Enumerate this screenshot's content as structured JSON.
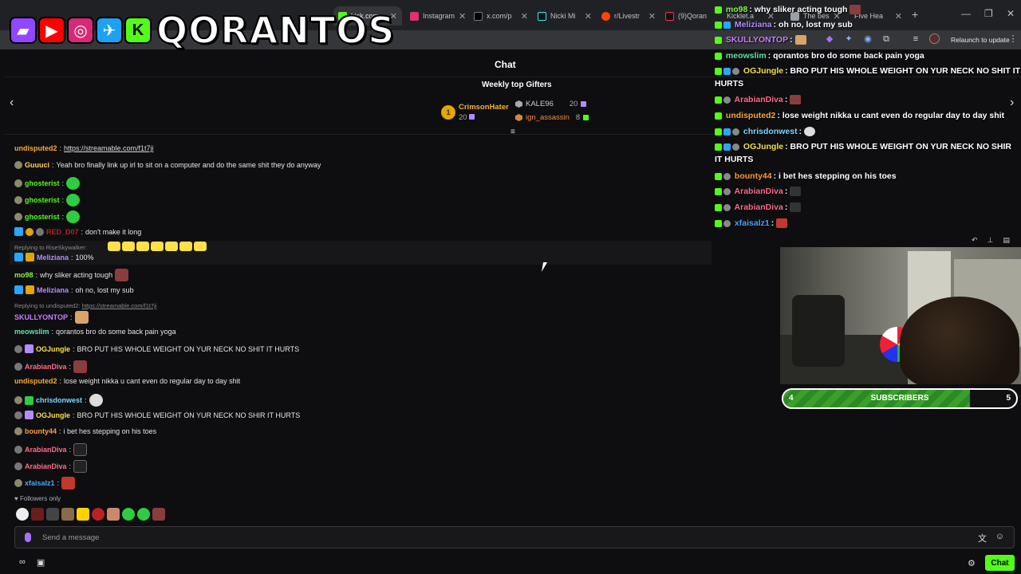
{
  "browser": {
    "tabs": [
      {
        "label": "kick.com",
        "active": true
      },
      {
        "label": "Instagram"
      },
      {
        "label": "x.com/p"
      },
      {
        "label": "Nicki Mi"
      },
      {
        "label": "r/Livestr"
      },
      {
        "label": "(9)Qoran"
      },
      {
        "label": "Kicklet.a"
      },
      {
        "label": "The bes"
      },
      {
        "label": "Five Hea"
      }
    ],
    "relaunch_label": "Relaunch to update"
  },
  "logo": {
    "text": "QORANTOS",
    "icons": [
      "twitch-logo-icon",
      "youtube-logo-icon",
      "instagram-logo-icon",
      "twitter-logo-icon",
      "kick-logo-icon"
    ]
  },
  "chat": {
    "title": "Chat",
    "weekly_title": "Weekly top Gifters",
    "gifters": [
      {
        "rank": "1",
        "name": "CrimsonHater",
        "count": "20"
      },
      {
        "name": "KALE96",
        "count": "20"
      },
      {
        "name": "ign_assassin",
        "count": "8"
      }
    ],
    "messages": [
      {
        "user": "undisputed2",
        "text": "",
        "link": "https://streamable.com/f1t7ji",
        "color": "#f8a935"
      },
      {
        "user": "Guuuci",
        "text": "Yeah bro finally link up irl to sit on a computer and do the same shit they do anyway",
        "color": "#ffd35c"
      },
      {
        "user": "ghosterist",
        "text": "",
        "color": "#53fc18"
      },
      {
        "user": "ghosterist",
        "text": "",
        "color": "#53fc18"
      },
      {
        "user": "ghosterist",
        "text": "",
        "color": "#53fc18"
      },
      {
        "user": "RED_D07",
        "text": "don't make it long",
        "color": "#b22222"
      },
      {
        "user": "Meliziana",
        "text": "100%",
        "color": "#b48cff",
        "reply": "Replying to RiseSkywalker:"
      },
      {
        "user": "mo98",
        "text": "why sliker acting tough",
        "color": "#8cf542"
      },
      {
        "user": "Meliziana",
        "text": "oh no, lost my sub",
        "color": "#b48cff"
      },
      {
        "user": "SKULLYONTOP",
        "text": "",
        "color": "#c77dff",
        "reply": "Replying to undisputed2:",
        "reply_link": "https://streamable.com/f1t7ji"
      },
      {
        "user": "meowslim",
        "text": "qorantos bro do some back pain yoga",
        "color": "#5fe3b0"
      },
      {
        "user": "OGJungle",
        "text": "BRO PUT HIS WHOLE WEIGHT ON YUR NECK NO SHIT IT HURTS",
        "color": "#f9e04b"
      },
      {
        "user": "ArabianDiva",
        "text": "",
        "color": "#ff6b8b"
      },
      {
        "user": "undisputed2",
        "text": "lose weight nikka u cant even do regular day to day shit",
        "color": "#f8a935"
      },
      {
        "user": "chrisdonwest",
        "text": "",
        "color": "#7fd6ff"
      },
      {
        "user": "OGJungle",
        "text": "BRO PUT HIS WHOLE WEIGHT ON YUR NECK NO SHIR IT HURTS",
        "color": "#f9e04b"
      },
      {
        "user": "bounty44",
        "text": "i bet hes stepping on his toes",
        "color": "#ff9b3d"
      },
      {
        "user": "ArabianDiva",
        "text": "",
        "color": "#ff6b8b"
      },
      {
        "user": "ArabianDiva",
        "text": "",
        "color": "#ff6b8b"
      },
      {
        "user": "xfaisalz1",
        "text": "",
        "color": "#4aa3ff"
      }
    ],
    "followers_only": "Followers only",
    "input_placeholder": "Send a message",
    "chat_button": "Chat"
  },
  "overlay_chat": [
    {
      "user": "mo98",
      "text": "why sliker acting tough",
      "color": "#8cf542"
    },
    {
      "user": "Meliziana",
      "text": "oh no, lost my sub",
      "color": "#b48cff"
    },
    {
      "user": "SKULLYONTOP",
      "text": "",
      "color": "#c77dff"
    },
    {
      "user": "meowslim",
      "text": "qorantos bro do some back pain yoga",
      "color": "#5fe3b0"
    },
    {
      "user": "OGJungle",
      "text": "BRO PUT HIS WHOLE WEIGHT ON YUR NECK NO SHIT IT HURTS",
      "color": "#f9e04b"
    },
    {
      "user": "ArabianDiva",
      "text": "",
      "color": "#ff6b8b"
    },
    {
      "user": "undisputed2",
      "text": "lose weight nikka u cant even do regular day to day shit",
      "color": "#f8a935"
    },
    {
      "user": "chrisdonwest",
      "text": "",
      "color": "#7fd6ff"
    },
    {
      "user": "OGJungle",
      "text": "BRO PUT HIS WHOLE WEIGHT ON YUR NECK NO SHIR IT HURTS",
      "color": "#f9e04b"
    },
    {
      "user": "bounty44",
      "text": "i bet hes stepping on his toes",
      "color": "#ff9b3d"
    },
    {
      "user": "ArabianDiva",
      "text": "",
      "color": "#ff6b8b"
    },
    {
      "user": "ArabianDiva",
      "text": "",
      "color": "#ff6b8b"
    },
    {
      "user": "xfaisalz1",
      "text": "",
      "color": "#4aa3ff"
    }
  ],
  "sub_goal": {
    "current": "4",
    "label": "SUBSCRIBERS",
    "target": "5",
    "progress": 0.8
  },
  "colors": {
    "kick_green": "#53fc18",
    "background": "#0e0e10"
  }
}
